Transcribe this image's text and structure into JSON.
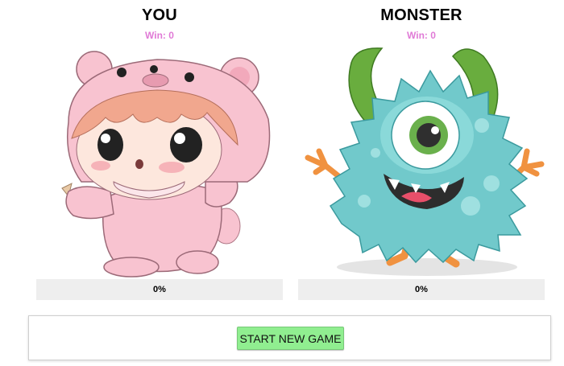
{
  "players": {
    "you": {
      "name": "YOU",
      "win_label": "Win:",
      "wins": "0",
      "health_percent_text": "0%",
      "health_percent": 0
    },
    "monster": {
      "name": "MONSTER",
      "win_label": "Win:",
      "wins": "0",
      "health_percent_text": "0%",
      "health_percent": 0
    }
  },
  "controls": {
    "start_label": "START NEW GAME"
  },
  "colors": {
    "win_text": "#e07ad6",
    "health_track": "#eeeeee",
    "start_button": "#90ee90"
  },
  "avatars": {
    "you": "chibi-pink-bear-costume-character",
    "monster": "blue-furry-one-eyed-monster"
  }
}
